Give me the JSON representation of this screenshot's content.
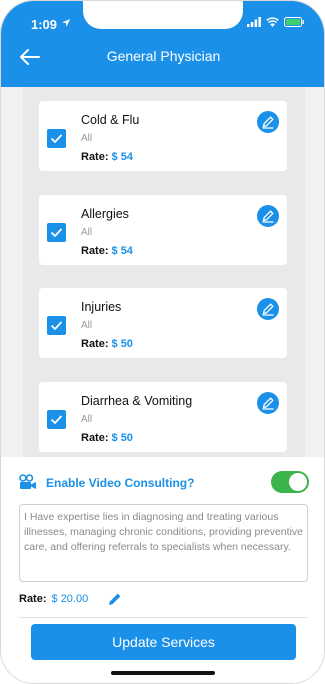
{
  "status": {
    "time": "1:09"
  },
  "header": {
    "title": "General Physician"
  },
  "services": [
    {
      "name": "Cold & Flu",
      "subtitle": "All",
      "rate_label": "Rate:",
      "rate": "$ 54"
    },
    {
      "name": "Allergies",
      "subtitle": "All",
      "rate_label": "Rate:",
      "rate": "$ 54"
    },
    {
      "name": "Injuries",
      "subtitle": "All",
      "rate_label": "Rate:",
      "rate": "$ 50"
    },
    {
      "name": "Diarrhea & Vomiting",
      "subtitle": "All",
      "rate_label": "Rate:",
      "rate": "$ 50"
    }
  ],
  "video": {
    "label": "Enable Video Consulting?",
    "enabled": true,
    "about": "I Have expertise lies in diagnosing and treating various illnesses, managing chronic conditions, providing preventive care, and offering referrals to specialists when necessary.",
    "rate_label": "Rate:",
    "rate": "$ 20.00"
  },
  "footer": {
    "button_label": "Update Services"
  },
  "colors": {
    "accent": "#1a90e8",
    "toggle_on": "#3bb44a"
  }
}
